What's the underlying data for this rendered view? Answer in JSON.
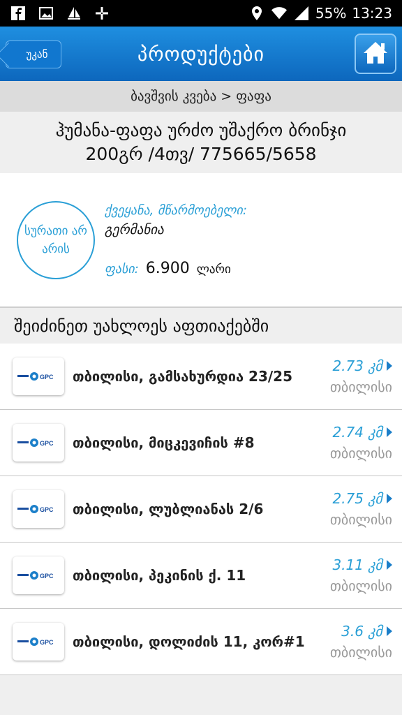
{
  "status": {
    "battery": "55%",
    "time": "13:23"
  },
  "appbar": {
    "back_label": "უკან",
    "title": "პროდუქტები"
  },
  "breadcrumb": "ბავშვის კვება > ფაფა",
  "product": {
    "name_line1": "ჰუმანა-ფაფა ურძო უშაქრო ბრინჯი",
    "name_line2": "200გრ /4თვ/ 775665/5658",
    "no_image_text": "სურათი არ არის",
    "country_label": "ქვეყანა, მწარმოებელი:",
    "country": "გერმანია",
    "price_label": "ფასი:",
    "price": "6.900",
    "currency": "ლარი"
  },
  "section_title": "შეიძინეთ უახლოეს აფთიაქებში",
  "pharmacies": [
    {
      "name": "თბილისი, გამსახურდია 23/25",
      "distance": "2.73 კმ",
      "city": "თბილისი"
    },
    {
      "name": "თბილისი, მიცკევიჩის #8",
      "distance": "2.74 კმ",
      "city": "თბილისი"
    },
    {
      "name": "თბილისი, ლუბლიანას 2/6",
      "distance": "2.75 კმ",
      "city": "თბილისი"
    },
    {
      "name": "თბილისი, პეკინის ქ. 11",
      "distance": "3.11 კმ",
      "city": "თბილისი"
    },
    {
      "name": "თბილისი, დოლიძის 11, კორ#1",
      "distance": "3.6 კმ",
      "city": "თბილისი"
    }
  ],
  "logo_text": "GPC",
  "colors": {
    "accent": "#2a9fd6",
    "appbar": "#0d67bd"
  }
}
